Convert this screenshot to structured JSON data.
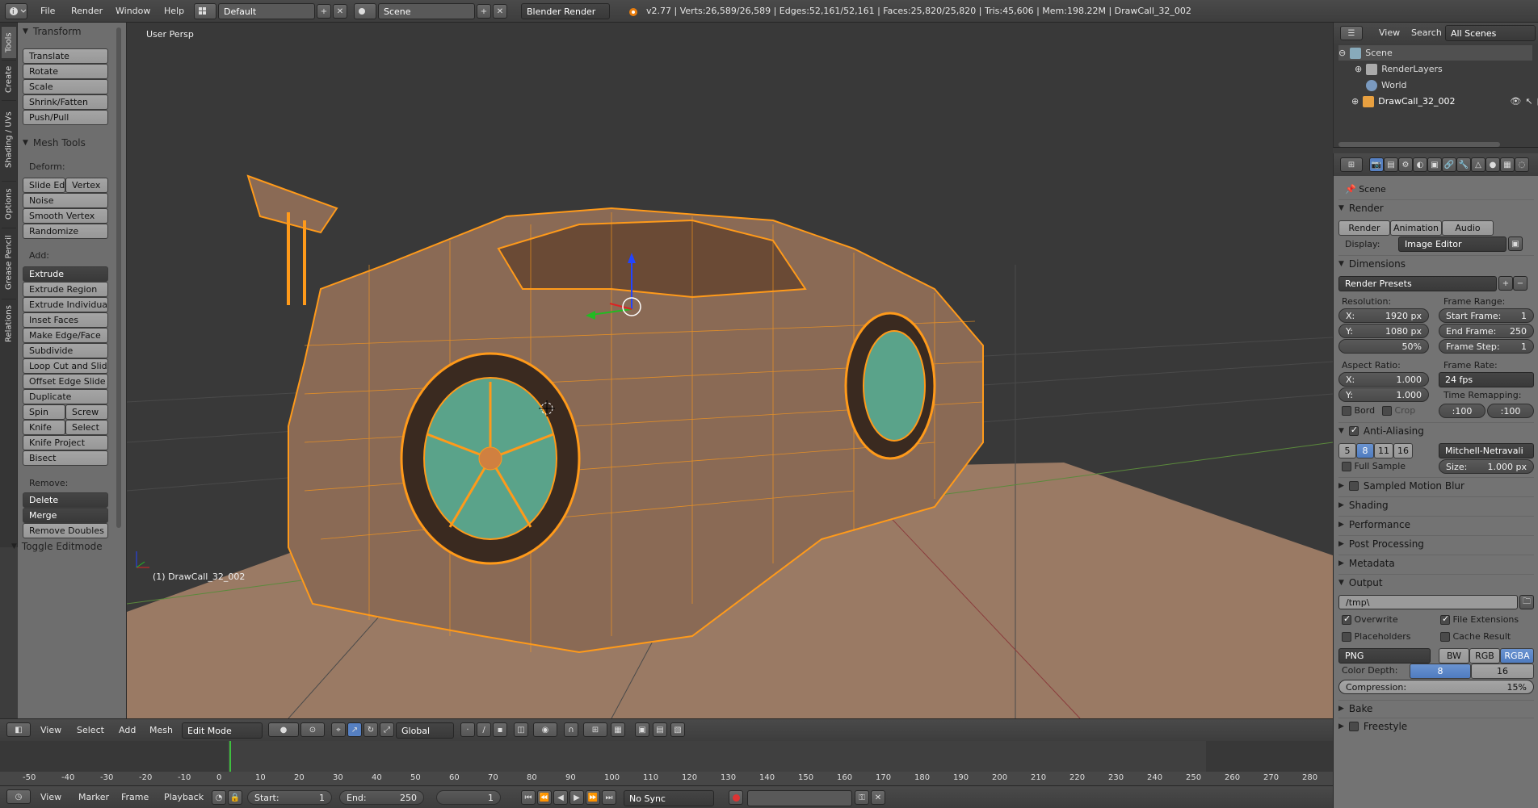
{
  "topbar": {
    "menus": [
      "File",
      "Render",
      "Window",
      "Help"
    ],
    "layout": "Default",
    "scene": "Scene",
    "engine": "Blender Render",
    "stats": "v2.77 | Verts:26,589/26,589 | Edges:52,161/52,161 | Faces:25,820/25,820 | Tris:45,606 | Mem:198.22M | DrawCall_32_002"
  },
  "tabs": [
    "Tools",
    "Create",
    "Shading / UVs",
    "Options",
    "Grease Pencil",
    "Relations"
  ],
  "toolshelf": {
    "transform": "Transform",
    "transform_tools": [
      "Translate",
      "Rotate",
      "Scale",
      "Shrink/Fatten",
      "Push/Pull"
    ],
    "mesh_tools": "Mesh Tools",
    "deform": "Deform:",
    "slide_edge": "Slide Ed",
    "vertex": "Vertex",
    "deform_tools": [
      "Noise",
      "Smooth Vertex",
      "Randomize"
    ],
    "add": "Add:",
    "extrude": "Extrude",
    "add_tools": [
      "Extrude Region",
      "Extrude Individual",
      "Inset Faces",
      "Make Edge/Face",
      "Subdivide",
      "Loop Cut and Slide",
      "Offset Edge Slide",
      "Duplicate"
    ],
    "spin": "Spin",
    "screw": "Screw",
    "knife": "Knife",
    "select": "Select",
    "knife_project": "Knife Project",
    "bisect": "Bisect",
    "remove": "Remove:",
    "delete": "Delete",
    "merge": "Merge",
    "remove_doubles": "Remove Doubles",
    "toggle": "Toggle Editmode"
  },
  "viewport": {
    "label": "User Persp",
    "object": "(1) DrawCall_32_002"
  },
  "outliner": {
    "menus": [
      "View",
      "Search"
    ],
    "filter": "All Scenes",
    "items": [
      "Scene",
      "RenderLayers",
      "World",
      "DrawCall_32_002"
    ]
  },
  "props": {
    "context": "Scene",
    "render": "Render",
    "render_btn": "Render",
    "animation_btn": "Animation",
    "audio_btn": "Audio",
    "display_lbl": "Display:",
    "display": "Image Editor",
    "dimensions": "Dimensions",
    "presets": "Render Presets",
    "resolution": "Resolution:",
    "res_x": "X:",
    "res_x_val": "1920 px",
    "res_y": "Y:",
    "res_y_val": "1080 px",
    "res_pct": "50%",
    "frame_range": "Frame Range:",
    "start_frame": "Start Frame:",
    "start_val": "1",
    "end_frame": "End Frame:",
    "end_val": "250",
    "frame_step": "Frame Step:",
    "step_val": "1",
    "aspect": "Aspect Ratio:",
    "asp_x": "X:",
    "asp_x_val": "1.000",
    "asp_y": "Y:",
    "asp_y_val": "1.000",
    "frame_rate": "Frame Rate:",
    "fps": "24 fps",
    "remap": "Time Remapping:",
    "remap_old": ":100",
    "remap_new": ":100",
    "bord": "Bord",
    "crop": "Crop",
    "aa": "Anti-Aliasing",
    "aa_samples": [
      "5",
      "8",
      "11",
      "16"
    ],
    "filter": "Mitchell-Netravali",
    "full_sample": "Full Sample",
    "size_lbl": "Size:",
    "size_val": "1.000 px",
    "smb": "Sampled Motion Blur",
    "shading": "Shading",
    "performance": "Performance",
    "post": "Post Processing",
    "metadata": "Metadata",
    "output": "Output",
    "path": "/tmp\\",
    "overwrite": "Overwrite",
    "file_ext": "File Extensions",
    "placeholders": "Placeholders",
    "cache": "Cache Result",
    "format": "PNG",
    "bw": "BW",
    "rgb": "RGB",
    "rgba": "RGBA",
    "color_depth": "Color Depth:",
    "cd8": "8",
    "cd16": "16",
    "compression": "Compression:",
    "compression_val": "15%",
    "bake": "Bake",
    "freestyle": "Freestyle"
  },
  "view3d_header": {
    "menus": [
      "View",
      "Select",
      "Add",
      "Mesh"
    ],
    "mode": "Edit Mode",
    "orientation": "Global"
  },
  "timeline": {
    "ticks": [
      "-50",
      "-40",
      "-30",
      "-20",
      "-10",
      "0",
      "10",
      "20",
      "30",
      "40",
      "50",
      "60",
      "70",
      "80",
      "90",
      "100",
      "110",
      "120",
      "130",
      "140",
      "150",
      "160",
      "170",
      "180",
      "190",
      "200",
      "210",
      "220",
      "230",
      "240",
      "250",
      "260",
      "270",
      "280"
    ],
    "current_frame": 1
  },
  "footer": {
    "menus": [
      "View",
      "Marker",
      "Frame",
      "Playback"
    ],
    "start_lbl": "Start:",
    "start": "1",
    "end_lbl": "End:",
    "end": "250",
    "frame": "1",
    "sync": "No Sync"
  }
}
